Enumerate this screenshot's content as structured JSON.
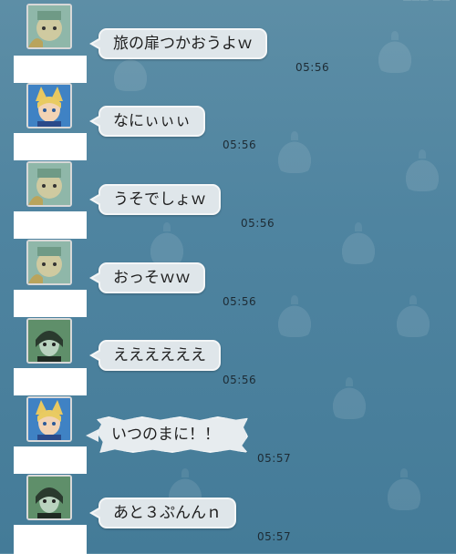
{
  "status_clip": "▀▀▀ ▀▀",
  "messages": [
    {
      "avatar": "green-robed-character-avatar",
      "text": "旅の扉つかおうよｗ",
      "time": "05:56",
      "style": "normal"
    },
    {
      "avatar": "blonde-catgirl-avatar",
      "text": "なにぃぃぃ",
      "time": "05:56",
      "style": "normal"
    },
    {
      "avatar": "green-robed-character-avatar",
      "text": "うそでしょｗ",
      "time": "05:56",
      "style": "normal"
    },
    {
      "avatar": "green-robed-character-avatar",
      "text": "おっそｗｗ",
      "time": "05:56",
      "style": "normal"
    },
    {
      "avatar": "dark-haired-elf-avatar",
      "text": "ええええええ",
      "time": "05:56",
      "style": "normal"
    },
    {
      "avatar": "blonde-catgirl-avatar",
      "text": "いつのまに！！",
      "time": "05:57",
      "style": "shout"
    },
    {
      "avatar": "dark-haired-elf-avatar",
      "text": "あと３ぷんんｎ",
      "time": "05:57",
      "style": "normal"
    }
  ]
}
